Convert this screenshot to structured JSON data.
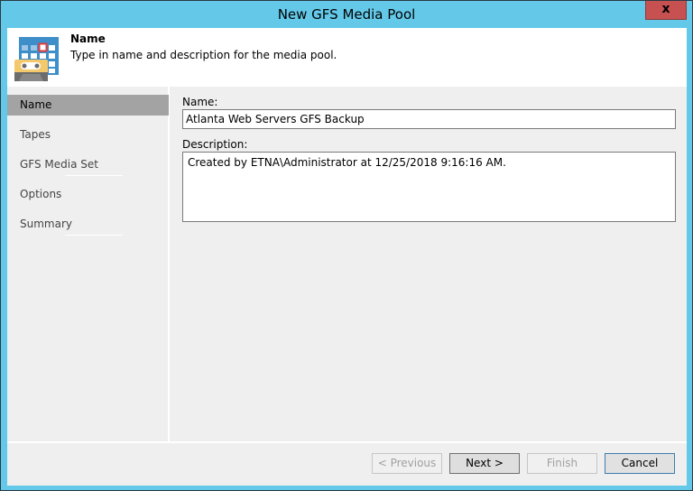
{
  "window": {
    "title": "New GFS Media Pool",
    "close_icon": "close-icon",
    "close_glyph": "x"
  },
  "header": {
    "icon": "media-pool-tape-calendar-icon",
    "title": "Name",
    "subtitle": "Type in name and description for the media pool."
  },
  "sidebar": {
    "items": [
      {
        "label": "Name",
        "active": true
      },
      {
        "label": "Tapes",
        "active": false
      },
      {
        "label": "GFS Media Set",
        "active": false
      },
      {
        "label": "Options",
        "active": false
      },
      {
        "label": "Summary",
        "active": false
      }
    ]
  },
  "form": {
    "name_label": "Name:",
    "name_value": "Atlanta Web Servers GFS Backup",
    "description_label": "Description:",
    "description_value": "Created by ETNA\\Administrator at 12/25/2018 9:16:16 AM."
  },
  "footer": {
    "previous_label": "< Previous",
    "next_label": "Next >",
    "finish_label": "Finish",
    "cancel_label": "Cancel"
  },
  "colors": {
    "title_bar": "#64c9e9",
    "close_button": "#c75050",
    "active_nav": "#a3a3a3"
  }
}
